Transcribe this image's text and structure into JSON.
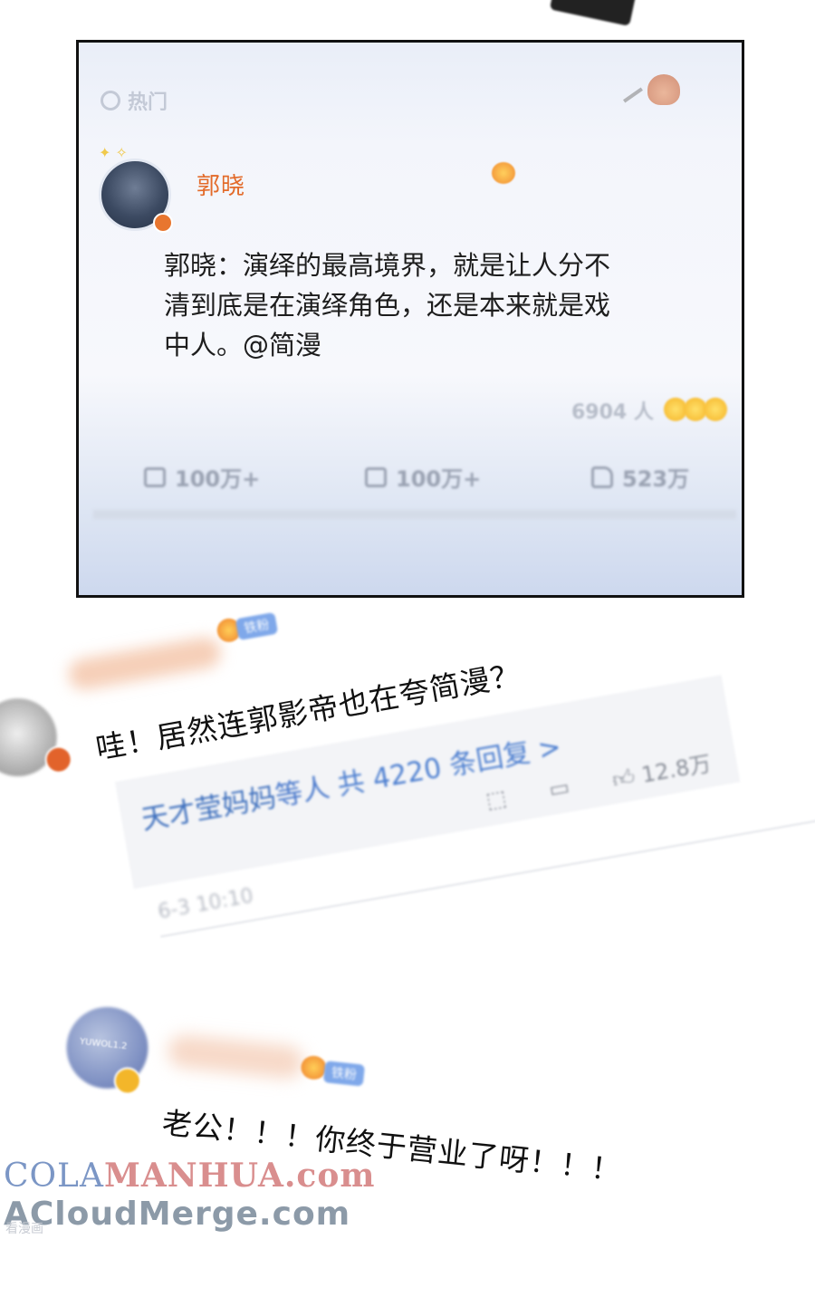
{
  "post": {
    "tab_label": "热门",
    "username": "郭晓",
    "text": "郭晓：演绎的最高境界，就是让人分不清到底是在演绎角色，还是本来就是戏中人。@简漫",
    "reaction_count": "6904 人",
    "repost_count": "100万+",
    "comment_count": "100万+",
    "like_count": "523万"
  },
  "comments": [
    {
      "tag": "铁粉",
      "text": "哇！居然连郭影帝也在夸简漫？",
      "reply_users": "天才莹妈妈",
      "reply_suffix": "等人",
      "reply_count": "共 4220 条回复 >",
      "likes": "12.8万",
      "time": "6-3 10:10"
    },
    {
      "tag": "铁粉",
      "avatar_text": "YUWOL1.2",
      "text": "老公！！！你终于营业了呀！！！"
    }
  ],
  "watermark": {
    "line1_a": "COLA",
    "line1_b": "MANHUA.com",
    "line2": "ACloudMerge.com",
    "line3": "看漫画"
  }
}
